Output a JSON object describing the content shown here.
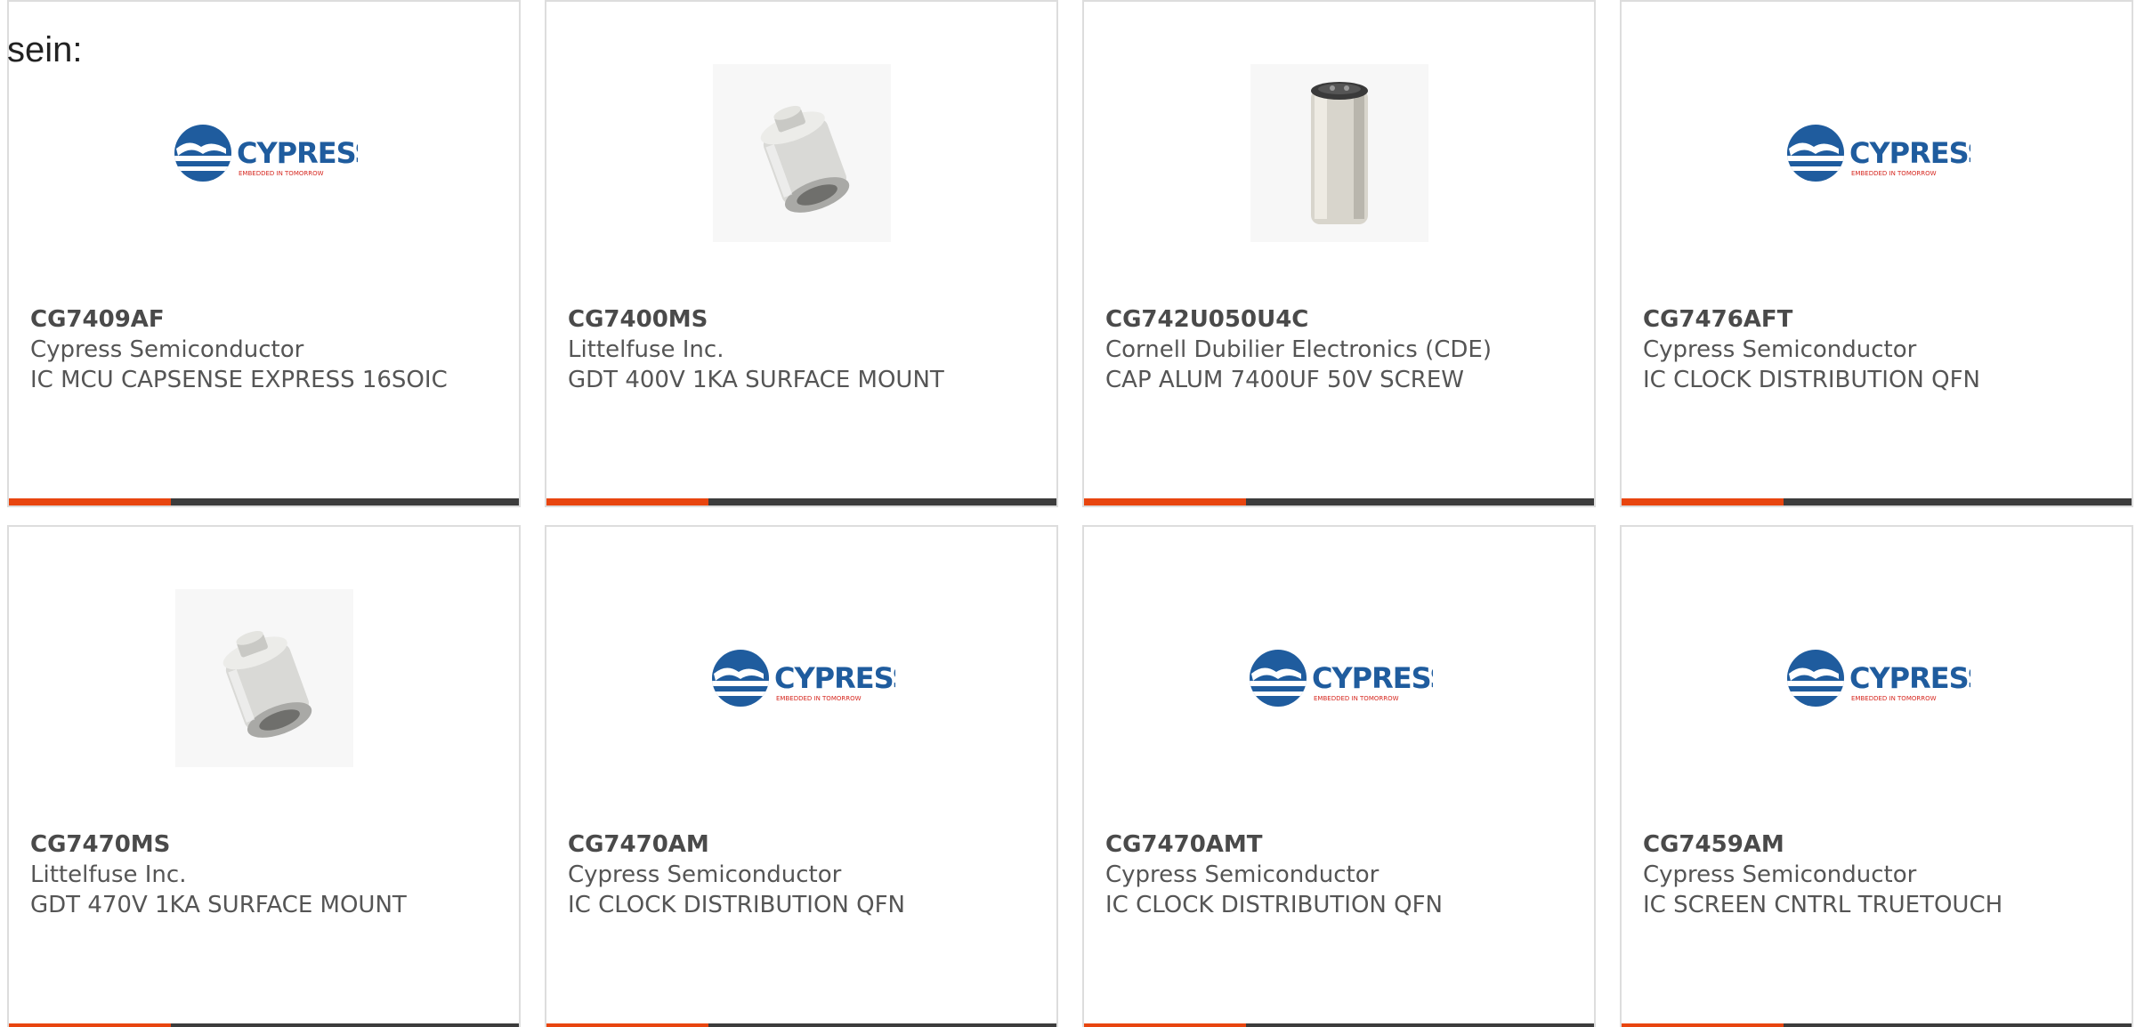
{
  "intro_text": "sein:",
  "colors": {
    "accent": "#e8450f",
    "bar": "#3c3c3c",
    "border": "#dddddd",
    "cypress_blue": "#1f5c9e",
    "cypress_red": "#d6261e"
  },
  "logo": {
    "brand": "CYPRESS",
    "tagline": "EMBEDDED IN TOMORROW"
  },
  "products": [
    {
      "part": "CG7409AF",
      "manufacturer": "Cypress Semiconductor",
      "description": "IC MCU CAPSENSE EXPRESS 16SOIC",
      "image": "cypress-logo"
    },
    {
      "part": "CG7400MS",
      "manufacturer": "Littelfuse Inc.",
      "description": "GDT 400V 1KA SURFACE MOUNT",
      "image": "gdt-component"
    },
    {
      "part": "CG742U050U4C",
      "manufacturer": "Cornell Dubilier Electronics (CDE)",
      "description": "CAP ALUM 7400UF 50V SCREW",
      "image": "capacitor-can"
    },
    {
      "part": "CG7476AFT",
      "manufacturer": "Cypress Semiconductor",
      "description": "IC CLOCK DISTRIBUTION QFN",
      "image": "cypress-logo"
    },
    {
      "part": "CG7470MS",
      "manufacturer": "Littelfuse Inc.",
      "description": "GDT 470V 1KA SURFACE MOUNT",
      "image": "gdt-component"
    },
    {
      "part": "CG7470AM",
      "manufacturer": "Cypress Semiconductor",
      "description": "IC CLOCK DISTRIBUTION QFN",
      "image": "cypress-logo"
    },
    {
      "part": "CG7470AMT",
      "manufacturer": "Cypress Semiconductor",
      "description": "IC CLOCK DISTRIBUTION QFN",
      "image": "cypress-logo"
    },
    {
      "part": "CG7459AM",
      "manufacturer": "Cypress Semiconductor",
      "description": "IC SCREEN CNTRL TRUETOUCH",
      "image": "cypress-logo"
    }
  ]
}
